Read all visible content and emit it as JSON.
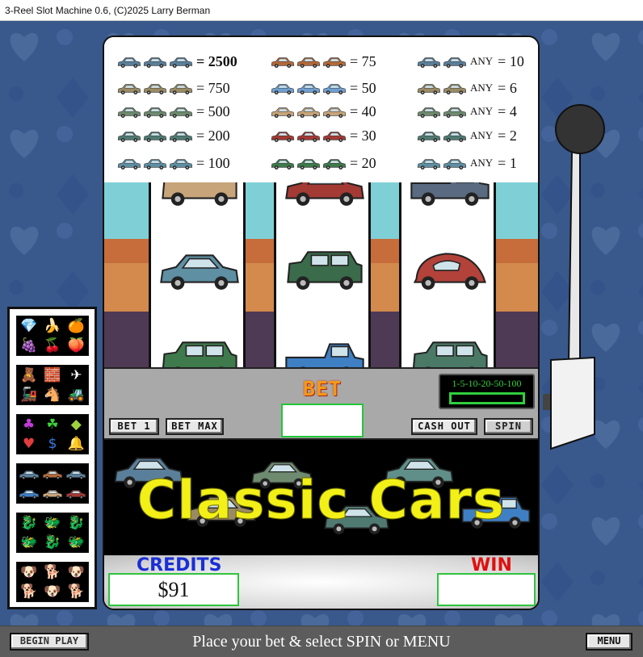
{
  "window": {
    "title": "3-Reel Slot Machine  0.6, (C)2025 Larry Berman"
  },
  "paytable": {
    "columns": [
      [
        {
          "cars": [
            "#5a7f9a",
            "#5a7f9a",
            "#5a7f9a"
          ],
          "value": "= 2500",
          "bold": true
        },
        {
          "cars": [
            "#9a8b64",
            "#9a8b64",
            "#9a8b64"
          ],
          "value": "= 750"
        },
        {
          "cars": [
            "#6e8a6f",
            "#6e8a6f",
            "#6e8a6f"
          ],
          "value": "= 500"
        },
        {
          "cars": [
            "#4f7a72",
            "#4f7a72",
            "#4f7a72"
          ],
          "value": "= 200"
        },
        {
          "cars": [
            "#5f8fa3",
            "#5f8fa3",
            "#5f8fa3"
          ],
          "value": "= 100"
        }
      ],
      [
        {
          "cars": [
            "#b26a3a",
            "#b26a3a",
            "#b26a3a"
          ],
          "value": "= 75"
        },
        {
          "cars": [
            "#6e9fd0",
            "#6e9fd0",
            "#6e9fd0"
          ],
          "value": "= 50"
        },
        {
          "cars": [
            "#c7a47a",
            "#c7a47a",
            "#c7a47a"
          ],
          "value": "= 40"
        },
        {
          "cars": [
            "#a33a34",
            "#a33a34",
            "#a33a34"
          ],
          "value": "= 30"
        },
        {
          "cars": [
            "#3f7a4c",
            "#3f7a4c",
            "#3f7a4c"
          ],
          "value": "= 20"
        }
      ],
      [
        {
          "cars": [
            "#5a7f9a",
            "#5a7f9a"
          ],
          "any": "ANY",
          "value": "= 10"
        },
        {
          "cars": [
            "#9a8b64",
            "#9a8b64"
          ],
          "any": "ANY",
          "value": "= 6"
        },
        {
          "cars": [
            "#6e8a6f",
            "#6e8a6f"
          ],
          "any": "ANY",
          "value": "= 4"
        },
        {
          "cars": [
            "#4f7a72",
            "#4f7a72"
          ],
          "any": "ANY",
          "value": "= 2"
        },
        {
          "cars": [
            "#5f8fa3",
            "#5f8fa3"
          ],
          "any": "ANY",
          "value": "= 1"
        }
      ]
    ]
  },
  "reels": [
    {
      "symbols": [
        {
          "color": "#c7a47a",
          "kind": "jeep"
        },
        {
          "color": "#5f8fa3",
          "kind": "sedan"
        },
        {
          "color": "#3f7a4c",
          "kind": "suv"
        }
      ]
    },
    {
      "symbols": [
        {
          "color": "#a33a34",
          "kind": "sedan"
        },
        {
          "color": "#3a6b4a",
          "kind": "suv"
        },
        {
          "color": "#3f7fc4",
          "kind": "pickup"
        }
      ]
    },
    {
      "symbols": [
        {
          "color": "#5a6a80",
          "kind": "pickup"
        },
        {
          "color": "#b2423a",
          "kind": "beetle"
        },
        {
          "color": "#4a7a66",
          "kind": "suv"
        }
      ]
    }
  ],
  "controls": {
    "bet_one": "BET 1",
    "bet_max": "BET MAX",
    "bet_label": "BET",
    "bet_value": "",
    "cash_out": "CASH OUT",
    "spin": "SPIN",
    "denominations": "1-5-10-20-50-100"
  },
  "banner": {
    "title": "Classic Cars"
  },
  "meters": {
    "credits_label": "CREDITS",
    "credits_value": "$91",
    "win_label": "WIN",
    "win_value": "",
    "credits_color": "#1a2fd6",
    "win_color": "#e01010"
  },
  "game_menu": [
    {
      "name": "fruit-game",
      "icon": "fruit-icon"
    },
    {
      "name": "toys-game",
      "icon": "toys-icon"
    },
    {
      "name": "casino-game",
      "icon": "casino-icon"
    },
    {
      "name": "classic-cars-game",
      "icon": "classic-cars-icon"
    },
    {
      "name": "dragons-game",
      "icon": "dragons-icon"
    },
    {
      "name": "dogs-game",
      "icon": "dogs-icon"
    }
  ],
  "statusbar": {
    "left_button": "BEGIN PLAY",
    "message": "Place your bet & select SPIN or MENU",
    "menu_button": "MENU"
  },
  "colors": {
    "accent_green": "#22c53a",
    "bet_orange": "#f29a1a",
    "banner_yellow": "#f3f018"
  }
}
